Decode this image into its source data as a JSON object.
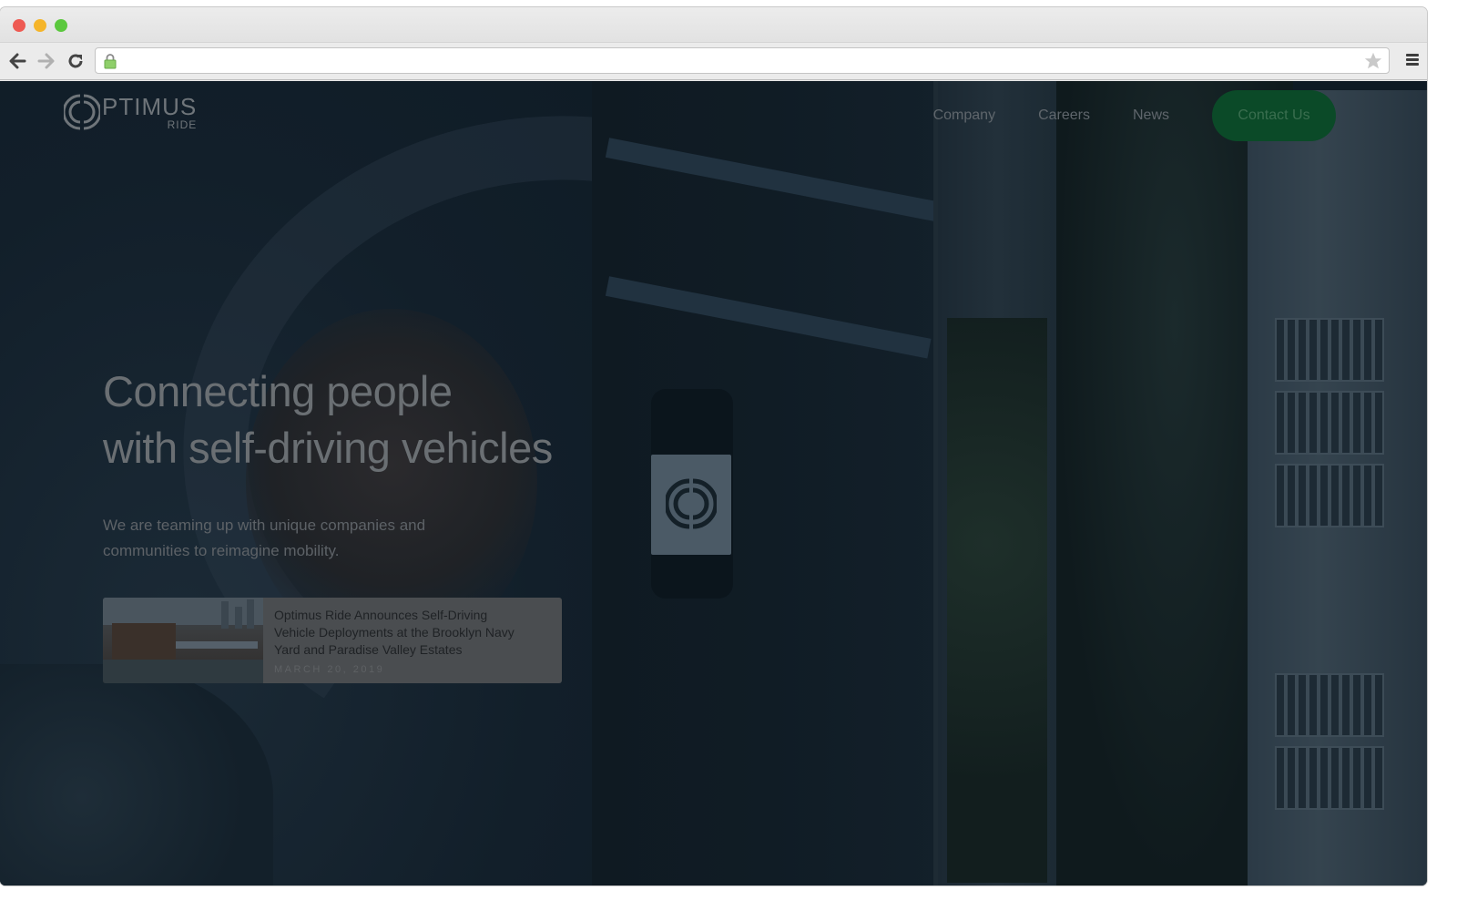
{
  "browser": {
    "url": "",
    "traffic_lights": [
      "close",
      "minimize",
      "maximize"
    ],
    "icons": {
      "back": "arrow-left-icon",
      "forward": "arrow-right-icon",
      "reload": "reload-icon",
      "lock": "lock-icon",
      "bookmark": "star-icon",
      "menu": "hamburger-menu-icon"
    }
  },
  "site": {
    "logo": {
      "main": "PTIMUS",
      "sub": "RIDE"
    },
    "nav": {
      "items": [
        {
          "label": "Company"
        },
        {
          "label": "Careers"
        },
        {
          "label": "News"
        }
      ],
      "cta": "Contact Us"
    },
    "hero": {
      "title_line1": "Connecting people",
      "title_line2": "with self-driving vehicles",
      "subtitle": "We are teaming up with unique companies and communities to reimagine mobility."
    },
    "news_card": {
      "title": "Optimus Ride Announces Self-Driving Vehicle Deployments at the Brooklyn Navy Yard and Paradise Valley Estates",
      "date": "MARCH 20, 2019"
    }
  },
  "colors": {
    "cta_green": "#0b4a28",
    "overlay": "#0e1a24"
  }
}
